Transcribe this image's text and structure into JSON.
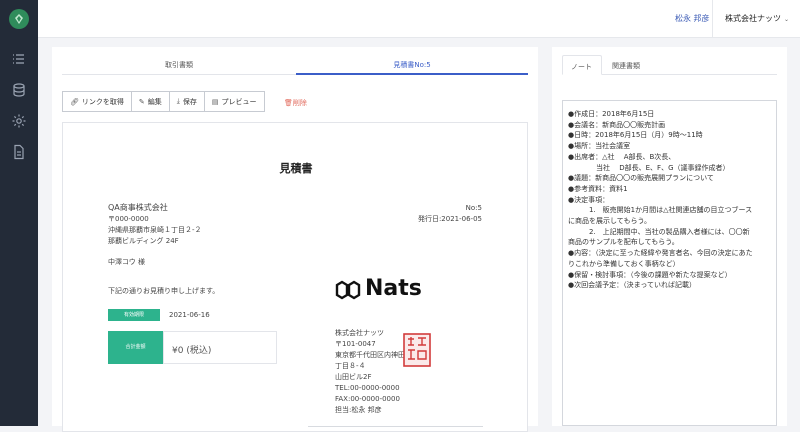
{
  "app": {
    "logo": "leaf-logo",
    "accent": "#3b5ec8",
    "success": "#2db38d"
  },
  "sidebar": {
    "icons": [
      "list-icon",
      "database-icon",
      "gear-icon",
      "document-icon"
    ]
  },
  "header": {
    "user_name": "松永 邦彦",
    "company": "株式会社ナッツ"
  },
  "left_tabs": [
    {
      "label": "取引書類"
    },
    {
      "label": "見積書No:5"
    }
  ],
  "toolbar": {
    "get_link": "リンクを取得",
    "edit": "編集",
    "save": "保存",
    "preview": "プレビュー",
    "delete": "削除"
  },
  "document": {
    "title": "見積書",
    "client_company": "QA商事株式会社",
    "client_address": [
      "〒000-0000",
      "沖縄県那覇市泉崎１丁目２-２",
      "那覇ビルディング 24F"
    ],
    "client_person": "中澤コウ 様",
    "number": "No:5",
    "issue_date": "発行日:2021-06-05",
    "message": "下記の通りお見積り申し上げます。",
    "valid_label": "有効期限",
    "valid_date": "2021-06-16",
    "total_label": "合計金額",
    "total_value": "¥0 (税込)",
    "brand": "Nats",
    "issuer_lines": [
      "株式会社ナッツ",
      "〒101-0047",
      "東京都千代田区内神田",
      "丁目８-４",
      "山田ビル2F",
      "TEL:00-0000-0000",
      "FAX:00-0000-0000",
      "担当:松永 邦彦"
    ]
  },
  "right_tabs": [
    {
      "label": "ノート",
      "active": true
    },
    {
      "label": "関連書類",
      "active": false
    }
  ],
  "note_text": "●作成日：2018年6月15日\n●会議名：新商品〇〇販売計画\n●日時：2018年6月15日（月）9時〜11時\n●場所：当社会議室\n●出席者：△社　 A部長、B次長、\n　　　　当社　 D部長、E、F、G（議事録作成者）\n●議題：新商品〇〇の販売展開プランについて\n●参考資料：資料1\n●決定事項：\n　　　1.　販売開始1か月間は△社関連店舗の目立つブース\nに商品を展示してもらう。\n　　　2.　上記期間中、当社の製品購入者様には、〇〇新\n商品のサンプルを配布してもらう。\n●内容：（決定に至った経緯や発言者名、今回の決定にあた\nりこれから準備しておく事柄など）\n●保留・検討事項：（今後の課題や新たな提案など）\n●次回会議予定：（決まっていれば記載）"
}
